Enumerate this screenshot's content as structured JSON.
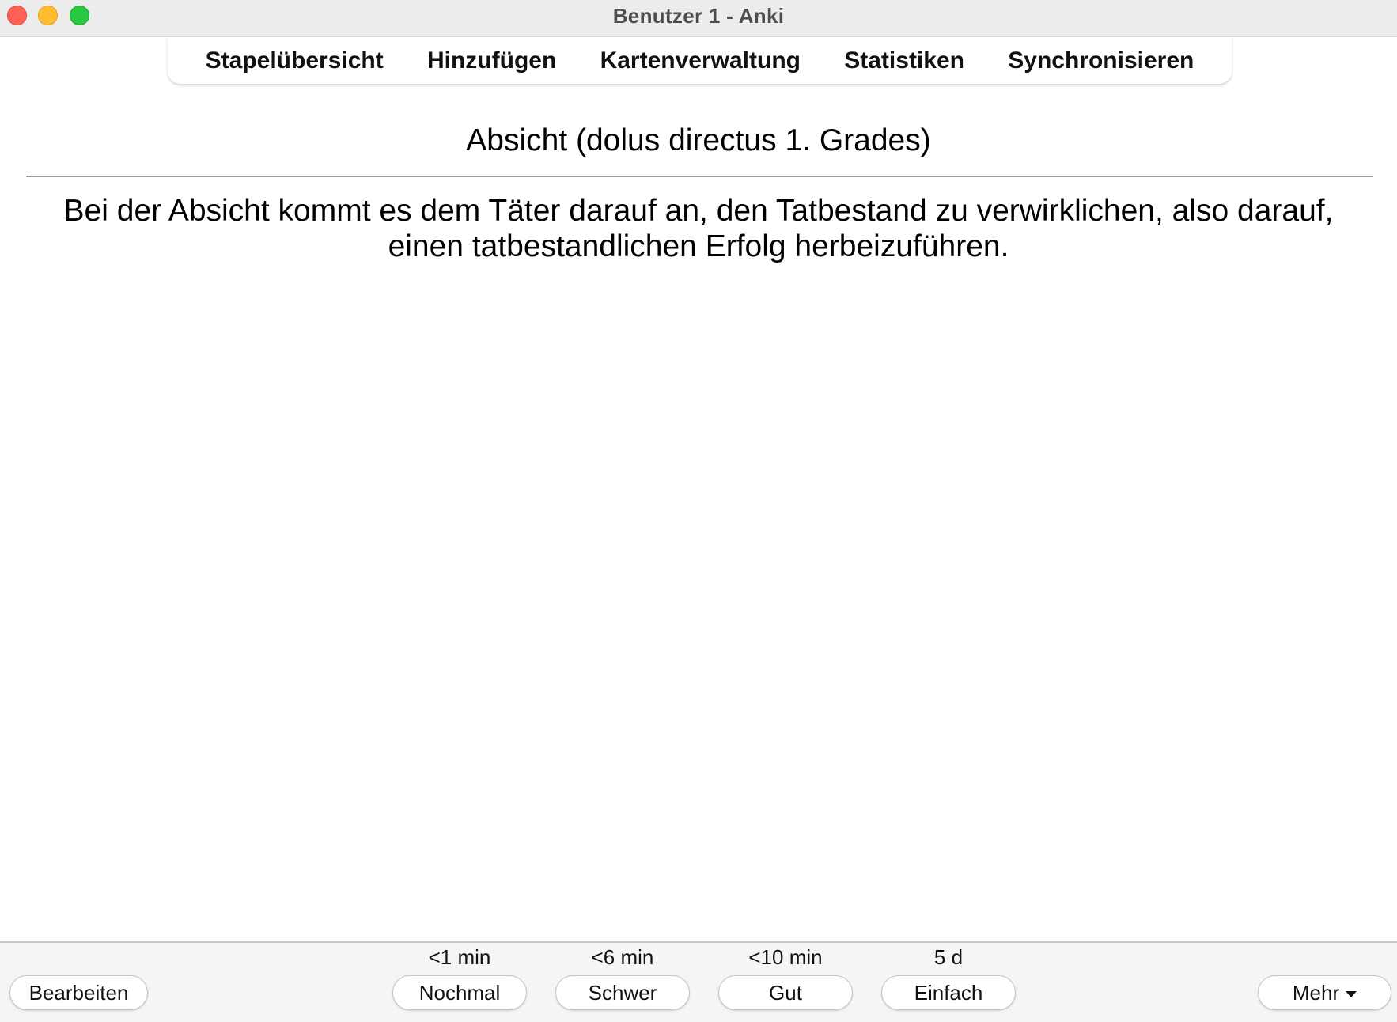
{
  "window": {
    "title": "Benutzer 1 - Anki"
  },
  "toolbar": {
    "items": [
      {
        "label": "Stapelübersicht"
      },
      {
        "label": "Hinzufügen"
      },
      {
        "label": "Kartenverwaltung"
      },
      {
        "label": "Statistiken"
      },
      {
        "label": "Synchronisieren"
      }
    ]
  },
  "card": {
    "front": "Absicht (dolus directus 1. Grades)",
    "back": "Bei der Absicht kommt es dem Täter darauf an, den Tatbestand zu verwirklichen, also darauf, einen tatbestandlichen Erfolg herbeizuführen."
  },
  "bottom": {
    "edit_label": "Bearbeiten",
    "more_label": "Mehr",
    "answers": [
      {
        "interval": "<1 min",
        "label": "Nochmal"
      },
      {
        "interval": "<6 min",
        "label": "Schwer"
      },
      {
        "interval": "<10 min",
        "label": "Gut"
      },
      {
        "interval": "5 d",
        "label": "Einfach"
      }
    ]
  },
  "colors": {
    "close": "#fe5f57",
    "minimize": "#febc2e",
    "maximize": "#28c840"
  }
}
